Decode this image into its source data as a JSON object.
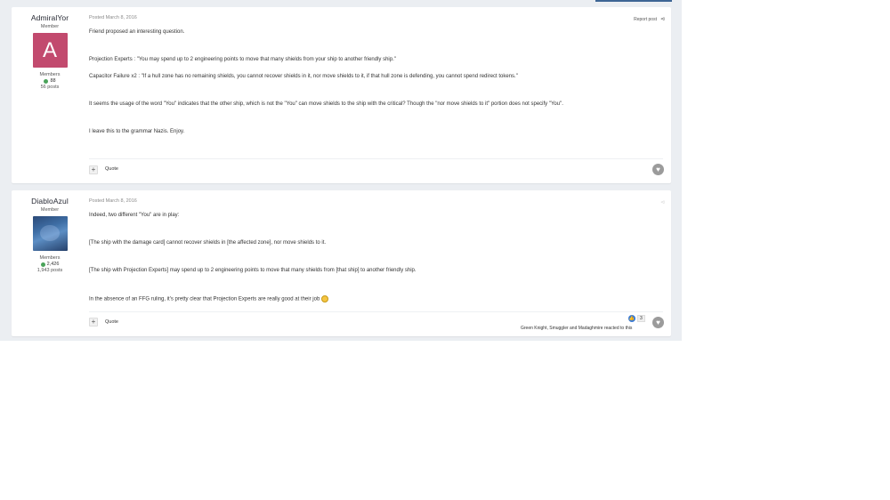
{
  "posts": [
    {
      "author": {
        "name": "AdmiralYor",
        "title": "Member",
        "avatar_letter": "A",
        "group": "Members",
        "reputation": "88",
        "posts": "56 posts"
      },
      "meta": "Posted March 8, 2016",
      "report_label": "Report post",
      "paragraphs": [
        "Friend proposed an interesting question.",
        "Projection Experts : \"You may spend up to 2 engineering points to move that many shields from your ship to another friendly ship.\"",
        "Capacitor Failure x2 : \"If a hull zone has no remaining shields, you cannot recover shields in it, nor move shields to it, if that hull zone is defending, you cannot spend redirect tokens.\"",
        "It seems the usage of the word \"You\" indicates that the other ship, which is not the \"You\" can move shields to the ship with the critical?  Though the \"nor move shields to it\" portion does not specify \"You\".",
        "I leave this to the grammar Nazis. Enjoy."
      ],
      "quote_label": "Quote"
    },
    {
      "author": {
        "name": "DiabloAzul",
        "title": "Member",
        "group": "Members",
        "reputation": "2,426",
        "posts": "1,943 posts"
      },
      "meta": "Posted March 8, 2016",
      "paragraphs": [
        "Indeed, two different \"You\" are in play:",
        "[The ship with the damage card] cannot recover shields in [the affected zone], nor move shields to it.",
        "[The ship with Projection Experts] may spend up to 2 engineering points to move that many shields from [that ship] to another friendly ship.",
        "In the absence of an FFG ruling, it's pretty clear that Projection Experts are really good at their job"
      ],
      "quote_label": "Quote",
      "reaction_count": "3",
      "reacted_text": "Green Knight, Smuggler and Madaghmire reacted to this"
    }
  ],
  "colors": {
    "accent": "#3d6594",
    "avatar_a": "#c24a6e",
    "rep_green": "#4aa35a",
    "like_blue": "#3b7bd4"
  }
}
